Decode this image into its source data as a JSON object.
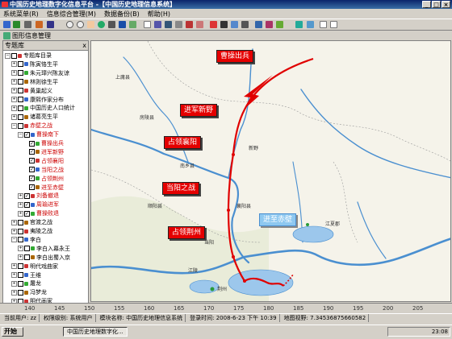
{
  "window": {
    "title": "中国历史地理数字化信息平台 -【中国历史地理信息系统】"
  },
  "menu": [
    "系统菜单(R)",
    "信息综合管理(M)",
    "数据备份(B)",
    "帮助(H)"
  ],
  "toolbar2": {
    "label": "图形信息管理"
  },
  "left_panel": {
    "header": "专题库",
    "close": "x",
    "tree": [
      {
        "level": 0,
        "label": "专题库目录",
        "red": false
      },
      {
        "level": 1,
        "label": "陈寅恪生平",
        "red": false
      },
      {
        "level": 1,
        "label": "朱元璋兴陈友谅",
        "red": false
      },
      {
        "level": 1,
        "label": "林则徐生平",
        "red": false
      },
      {
        "level": 1,
        "label": "黄巢起义",
        "red": false
      },
      {
        "level": 1,
        "label": "康熙作家分布",
        "red": false
      },
      {
        "level": 1,
        "label": "中国历史人口统计",
        "red": false
      },
      {
        "level": 1,
        "label": "诸葛亮生平",
        "red": false
      },
      {
        "level": 1,
        "label": "赤壁之战",
        "red": true
      },
      {
        "level": 2,
        "label": "曹操南下",
        "red": true
      },
      {
        "level": 3,
        "label": "曹操出兵",
        "red": true
      },
      {
        "level": 3,
        "label": "进军新野",
        "red": true
      },
      {
        "level": 3,
        "label": "占领襄阳",
        "red": true
      },
      {
        "level": 3,
        "label": "当阳之战",
        "red": true
      },
      {
        "level": 3,
        "label": "占领荆州",
        "red": true
      },
      {
        "level": 3,
        "label": "进至赤壁",
        "red": true
      },
      {
        "level": 2,
        "label": "刘备撤退",
        "red": true
      },
      {
        "level": 2,
        "label": "周瑜进军",
        "red": true
      },
      {
        "level": 2,
        "label": "曹操败退",
        "red": true
      },
      {
        "level": 1,
        "label": "官渡之战",
        "red": false
      },
      {
        "level": 1,
        "label": "夷陵之战",
        "red": false
      },
      {
        "level": 1,
        "label": "李白",
        "red": false
      },
      {
        "level": 2,
        "label": "李白入幕永王",
        "red": false
      },
      {
        "level": 2,
        "label": "李白出蜀入京",
        "red": false
      },
      {
        "level": 1,
        "label": "明代戏曲家",
        "red": false
      },
      {
        "level": 1,
        "label": "王维",
        "red": false
      },
      {
        "level": 1,
        "label": "屠龙",
        "red": false
      },
      {
        "level": 1,
        "label": "冯梦龙",
        "red": false
      },
      {
        "level": 1,
        "label": "明代画家",
        "red": false
      }
    ]
  },
  "map": {
    "labels": [
      {
        "id": "caocao-chubing",
        "text": "曹操出兵"
      },
      {
        "id": "jinjun-xinye",
        "text": "进军新野"
      },
      {
        "id": "zhanling-xiangyang",
        "text": "占领襄阳"
      },
      {
        "id": "dangyang",
        "text": "当阳之战"
      },
      {
        "id": "zhanling-jingzhou",
        "text": "占领荆州"
      },
      {
        "id": "jinzhi-chibi",
        "text": "进至赤壁"
      }
    ],
    "places": [
      "上庸县",
      "房陵县",
      "南乡县",
      "顺阳县",
      "新野",
      "襄阳县",
      "江夏郡",
      "江陵",
      "当阳",
      "荆州"
    ],
    "route_color": "#e00000",
    "river_color": "#4a8fd0",
    "lake_color": "#9cc7ec"
  },
  "scale_ticks": [
    "140",
    "145",
    "150",
    "155",
    "160",
    "165",
    "170",
    "175",
    "180",
    "185",
    "190",
    "195",
    "200",
    "205"
  ],
  "status": {
    "user": "当前用户: zz",
    "rights": "权限级别: 系统用户",
    "module": "模块名称: 中国历史地理信息系统",
    "login_time": "登录时间: 2008-6-23 下午 10:39",
    "scale": "地图视野: 7.34536875660582"
  },
  "taskbar": {
    "start": "开始",
    "task": "中国历史地理数字化...",
    "clock": "23:08"
  }
}
